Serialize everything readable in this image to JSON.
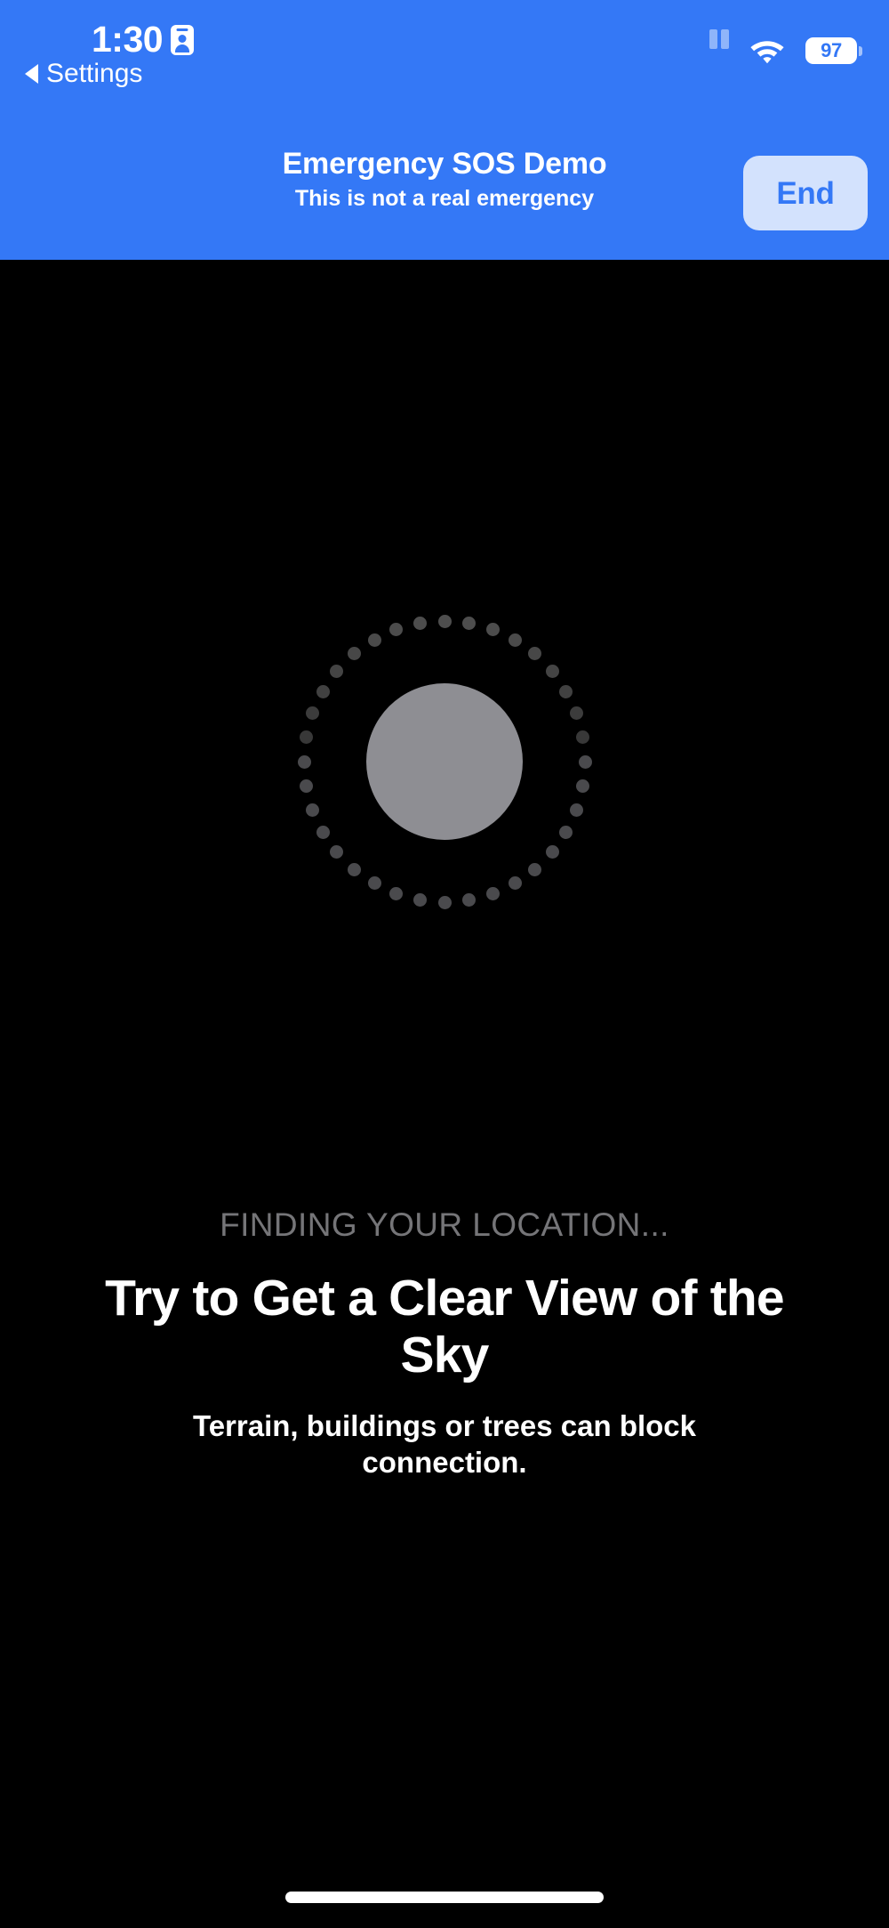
{
  "status_bar": {
    "time": "1:30",
    "hotspot_icon": "id-card-icon",
    "back_link": "Settings",
    "back_caret_icon": "caret-left-icon",
    "cellular_icon": "cellular-signal-icon",
    "wifi_icon": "wifi-icon",
    "battery_percent": "97",
    "battery_icon": "battery-icon"
  },
  "banner": {
    "title": "Emergency SOS Demo",
    "subtitle": "This is not a real emergency",
    "end_button_label": "End",
    "background_color": "#3478F6",
    "end_button_background": "#D3E2FD",
    "end_button_text_color": "#3478F6"
  },
  "indicator": {
    "name": "satellite-connection-indicator",
    "dot_count": 36,
    "dot_color": "#4A4A4D",
    "core_color": "#8E8E93"
  },
  "main": {
    "status_line": "FINDING YOUR LOCATION...",
    "headline": "Try to Get a Clear View of the Sky",
    "subline": "Terrain, buildings or trees can block connection.",
    "status_line_color": "#757578",
    "background_color": "#000000"
  },
  "home_indicator": {
    "name": "home-indicator"
  }
}
